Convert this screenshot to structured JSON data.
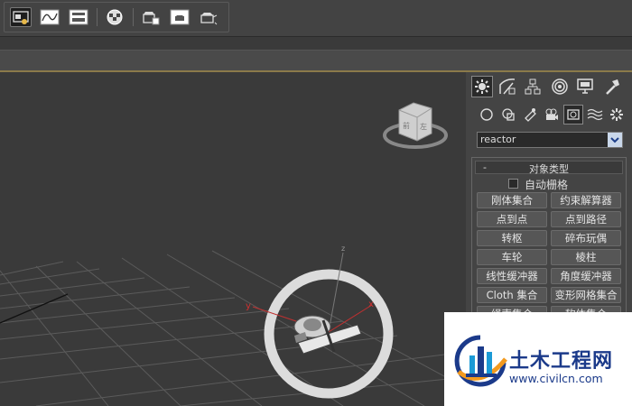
{
  "toolbar": {
    "icons": [
      "scene-explorer-icon",
      "curve-editor-icon",
      "schematic-view-icon",
      "material-editor-icon",
      "render-setup-icon",
      "rendered-frame-window-icon",
      "render-production-icon"
    ]
  },
  "viewport": {
    "axis_labels": {
      "x": "x",
      "y": "y",
      "z": "z"
    },
    "colors": {
      "background": "#3a3a3a",
      "grid": "#5b5b5b",
      "x_axis": "#d03030",
      "y_axis": "#d03030"
    }
  },
  "command_panel": {
    "tabs": [
      "create-tab",
      "modify-tab",
      "hierarchy-tab",
      "motion-tab",
      "display-tab",
      "utilities-tab"
    ],
    "categories": [
      "geometry",
      "shapes",
      "lights",
      "cameras",
      "helpers",
      "space-warps",
      "systems"
    ],
    "dropdown_value": "reactor",
    "rollout": {
      "collapse_symbol": "-",
      "title": "对象类型",
      "autogrid_label": "自动栅格",
      "buttons": [
        "刚体集合",
        "约束解算器",
        "点到点",
        "点到路径",
        "转枢",
        "碎布玩偶",
        "车轮",
        "棱柱",
        "线性缓冲器",
        "角度缓冲器",
        "Cloth 集合",
        "变形网格集合",
        "绳索集合",
        "软体集合"
      ]
    }
  },
  "watermark": {
    "title": "土木工程网",
    "url": "www.civilcn.com",
    "color": "#1b3a8a"
  }
}
